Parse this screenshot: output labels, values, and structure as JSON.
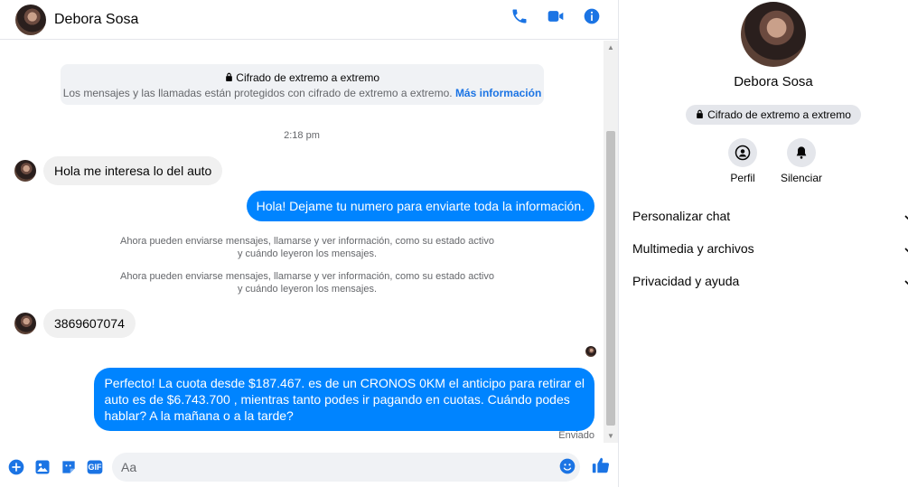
{
  "contact": {
    "name": "Debora Sosa"
  },
  "e2e": {
    "title": "Cifrado de extremo a extremo",
    "desc": "Los mensajes y las llamadas están protegidos con cifrado de extremo a extremo.",
    "link": "Más información"
  },
  "conversation": {
    "timestamp": "2:18 pm",
    "m1": "Hola me interesa lo del auto",
    "m2": "Hola! Dejame tu numero  para enviarte toda la información.",
    "note1_l1": "Ahora pueden enviarse mensajes, llamarse y ver información, como su estado activo",
    "note1_l2": "y cuándo leyeron los mensajes.",
    "note2_l1": "Ahora pueden enviarse mensajes, llamarse y ver información, como su estado activo",
    "note2_l2": "y cuándo leyeron los mensajes.",
    "m3": "3869607074",
    "m4_l1": "Perfecto! La cuota desde $187.467. es de un CRONOS 0KM el anticipo para retirar el",
    "m4_l2": "auto es de $6.743.700 , mientras tanto podes ir pagando en cuotas. Cuándo podes",
    "m4_l3": "hablar? A la mañana o a la tarde?",
    "status": "Enviado"
  },
  "composer": {
    "placeholder": "Aa",
    "gif_label": "GIF"
  },
  "sidebar": {
    "name": "Debora Sosa",
    "encryption_label": "Cifrado de extremo a extremo",
    "profile_label": "Perfil",
    "mute_label": "Silenciar",
    "sections": [
      "Personalizar chat",
      "Multimedia y archivos",
      "Privacidad y ayuda"
    ]
  },
  "colors": {
    "accent": "#0084ff",
    "icon": "#1b74e4"
  }
}
